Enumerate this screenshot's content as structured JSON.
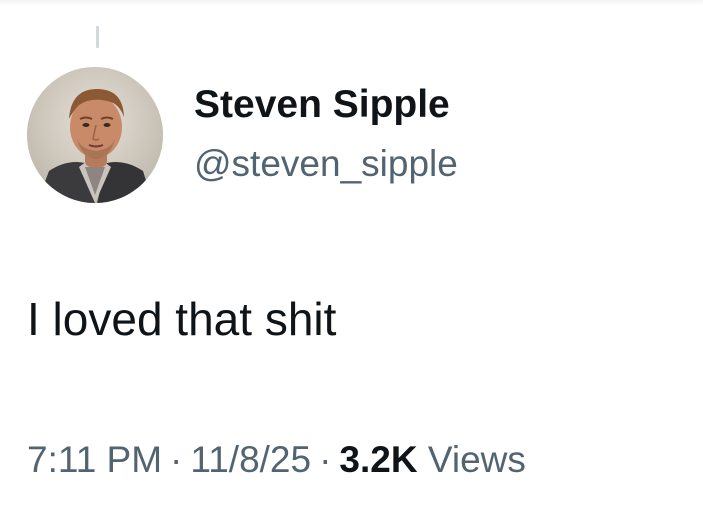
{
  "tweet": {
    "author": {
      "display_name": "Steven Sipple",
      "handle": "@steven_sipple",
      "avatar_icon": "user-profile-photo"
    },
    "text": "I loved that shit",
    "meta": {
      "time": "7:11 PM",
      "separator": "·",
      "date": "11/8/25",
      "views_count": "3.2K",
      "views_label": "Views"
    }
  },
  "colors": {
    "primary_text": "#0f1419",
    "secondary_text": "#536471",
    "thread_line": "#cfd9de",
    "background": "#ffffff"
  }
}
